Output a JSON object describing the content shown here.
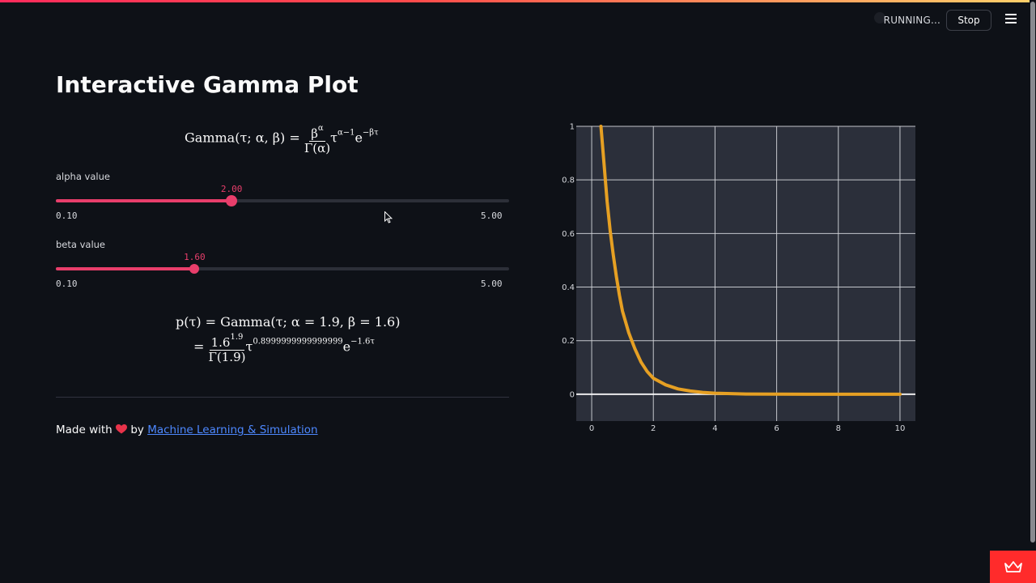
{
  "header": {
    "status": "RUNNING...",
    "stop_label": "Stop"
  },
  "page": {
    "title": "Interactive Gamma Plot"
  },
  "formula_top": {
    "lhs": "Gamma(τ; α, β) =",
    "num": "β",
    "num_sup": "α",
    "den": "Γ(α)",
    "tail1": "τ",
    "tail1_sup": "α−1",
    "tail2": "e",
    "tail2_sup": "−βτ"
  },
  "sliders": [
    {
      "label": "alpha value",
      "value": "2.00",
      "min": "0.10",
      "max": "5.00",
      "fraction": 0.3878
    },
    {
      "label": "beta value",
      "value": "1.60",
      "min": "0.10",
      "max": "5.00",
      "fraction": 0.3061
    }
  ],
  "formula_bottom": {
    "line1": "p(τ) = Gamma(τ; α = 1.9, β = 1.6)",
    "eq": "=",
    "num": "1.6",
    "num_sup": "1.9",
    "den": "Γ(1.9)",
    "tail1": "τ",
    "tail1_sup": "0.8999999999999999",
    "tail2": "e",
    "tail2_sup": "−1.6τ"
  },
  "footer": {
    "prefix": "Made with",
    "by": "by",
    "link": "Machine Learning & Simulation"
  },
  "colors": {
    "accent": "#e83e6b",
    "curve": "#e6a023",
    "plot_bg": "#2b2f3a",
    "page_bg": "#0e1117"
  },
  "chart_data": {
    "type": "line",
    "x_range": [
      -0.5,
      10.5
    ],
    "y_range": [
      -0.1,
      1.0
    ],
    "x_ticks": [
      0,
      2,
      4,
      6,
      8,
      10
    ],
    "y_ticks": [
      0,
      0.2,
      0.4,
      0.6,
      0.8,
      1
    ],
    "y_tick_labels": [
      "0",
      "0.2",
      "0.4",
      "0.6",
      "0.8",
      "1"
    ],
    "grid": true,
    "series": [
      {
        "x": [
          0.3,
          0.4,
          0.5,
          0.6,
          0.7,
          0.8,
          0.9,
          1.0,
          1.2,
          1.4,
          1.6,
          1.8,
          2.0,
          2.4,
          2.8,
          3.2,
          3.6,
          4.0,
          5.0,
          6.0,
          7.0,
          8.0,
          9.0,
          10.0
        ],
        "y": [
          1.0,
          0.86,
          0.72,
          0.61,
          0.52,
          0.44,
          0.37,
          0.31,
          0.23,
          0.17,
          0.12,
          0.085,
          0.06,
          0.035,
          0.02,
          0.012,
          0.007,
          0.004,
          0.001,
          0.0003,
          0.0001,
          0.0,
          0.0,
          0.0
        ]
      }
    ]
  }
}
